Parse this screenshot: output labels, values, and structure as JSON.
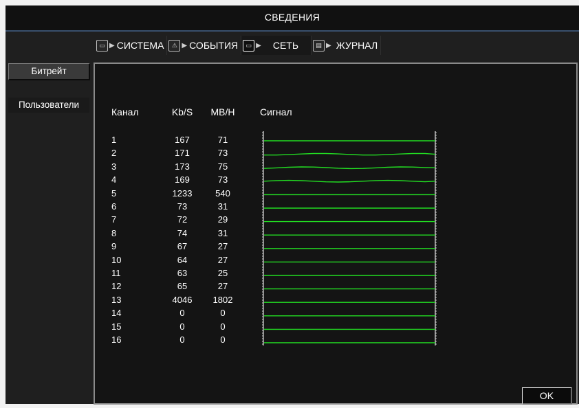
{
  "window": {
    "title": "СВЕДЕНИЯ"
  },
  "tabs": [
    {
      "label": "СИСТЕМА",
      "icon": "monitor-icon",
      "active": false
    },
    {
      "label": "СОБЫТИЯ",
      "icon": "warning-icon",
      "active": false
    },
    {
      "label": "СЕТЬ",
      "icon": "network-icon",
      "active": true
    },
    {
      "label": "ЖУРНАЛ",
      "icon": "log-icon",
      "active": false
    }
  ],
  "sidebar": {
    "items": [
      {
        "label": "Битрейт",
        "selected": true
      },
      {
        "label": "Пользователи",
        "selected": false
      }
    ]
  },
  "table": {
    "headers": {
      "channel": "Канал",
      "kbs": "Kb/S",
      "mbh": "MB/H",
      "signal": "Сигнал"
    },
    "rows": [
      {
        "channel": "1",
        "kbs": "167",
        "mbh": "71"
      },
      {
        "channel": "2",
        "kbs": "171",
        "mbh": "73"
      },
      {
        "channel": "3",
        "kbs": "173",
        "mbh": "75"
      },
      {
        "channel": "4",
        "kbs": "169",
        "mbh": "73"
      },
      {
        "channel": "5",
        "kbs": "1233",
        "mbh": "540"
      },
      {
        "channel": "6",
        "kbs": "73",
        "mbh": "31"
      },
      {
        "channel": "7",
        "kbs": "72",
        "mbh": "29"
      },
      {
        "channel": "8",
        "kbs": "74",
        "mbh": "31"
      },
      {
        "channel": "9",
        "kbs": "67",
        "mbh": "27"
      },
      {
        "channel": "10",
        "kbs": "64",
        "mbh": "27"
      },
      {
        "channel": "11",
        "kbs": "63",
        "mbh": "25"
      },
      {
        "channel": "12",
        "kbs": "65",
        "mbh": "27"
      },
      {
        "channel": "13",
        "kbs": "4046",
        "mbh": "1802"
      },
      {
        "channel": "14",
        "kbs": "0",
        "mbh": "0"
      },
      {
        "channel": "15",
        "kbs": "0",
        "mbh": "0"
      },
      {
        "channel": "16",
        "kbs": "0",
        "mbh": "0"
      }
    ]
  },
  "buttons": {
    "ok_label": "OK"
  },
  "colors": {
    "signal_line": "#22dd22",
    "panel_border": "#8a8a8a",
    "title_underline": "#39506d"
  }
}
